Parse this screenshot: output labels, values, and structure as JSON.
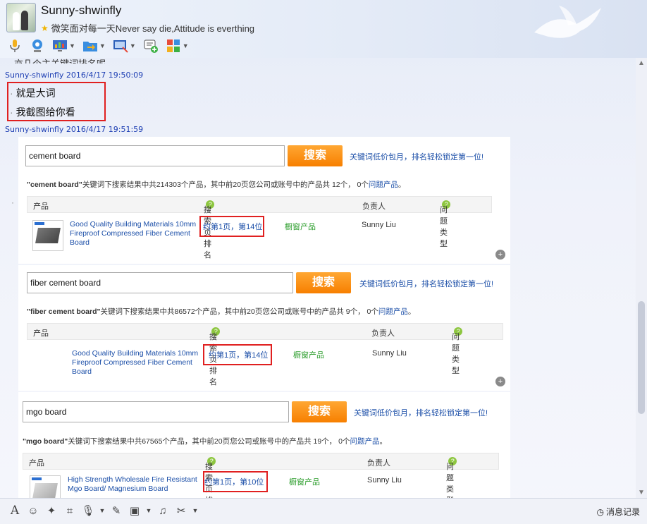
{
  "contact": {
    "name": "Sunny-shwinfly",
    "signature": "微笑面对每一天Never say die,Attitude is everthing"
  },
  "chat": {
    "cut_line": "亦几个主关键词排名呢",
    "messages": [
      {
        "header": "Sunny-shwinfly 2016/4/17 19:50:09",
        "lines": [
          "就是大词",
          "我截图给你看"
        ]
      },
      {
        "header": "Sunny-shwinfly 2016/4/17 19:51:59"
      }
    ]
  },
  "panels": [
    {
      "query": "cement board",
      "search_label": "搜索",
      "promo": "关键词低价包月，排名轻松锁定第一位!",
      "result_kw": "\"cement board\"",
      "result_text": "关键词下搜索结果中共214303个产品，其中前20页您公司或账号中的产品共 12个， 0个",
      "result_link": "问题产品",
      "result_end": "。",
      "headers": {
        "product": "产品",
        "rank": "搜索页排名",
        "owner": "负责人",
        "issue": "问题类型"
      },
      "row": {
        "title": "Good Quality Building Materials 10mm Fireproof Compressed Fiber Cement Board",
        "rank": "约第1页，第14位",
        "type": "橱窗产品",
        "owner": "Sunny Liu"
      }
    },
    {
      "query": "fiber cement board",
      "search_label": "搜索",
      "promo": "关键词低价包月，排名轻松锁定第一位!",
      "result_kw": "\"fiber cement board\"",
      "result_text": "关键词下搜索结果中共86572个产品，其中前20页您公司或账号中的产品共 9个， 0个",
      "result_link": "问题产品",
      "result_end": "。",
      "headers": {
        "product": "产品",
        "rank": "搜索页排名",
        "owner": "负责人",
        "issue": "问题类型"
      },
      "row": {
        "title": "Good Quality Building Materials 10mm Fireproof Compressed Fiber Cement Board",
        "rank": "约第1页，第14位",
        "type": "橱窗产品",
        "owner": "Sunny Liu"
      }
    },
    {
      "query": "mgo board",
      "search_label": "搜索",
      "promo": "关键词低价包月，排名轻松锁定第一位!",
      "result_kw": "\"mgo board\"",
      "result_text": "关键词下搜索结果中共67565个产品，其中前20页您公司或账号中的产品共 19个， 0个",
      "result_link": "问题产品",
      "result_end": "。",
      "headers": {
        "product": "产品",
        "rank": "搜索页排名",
        "owner": "负责人",
        "issue": "问题类型"
      },
      "row": {
        "title": "High Strength Wholesale Fire Resistant Mgo Board/ Magnesium Board",
        "rank": "约第1页，第10位",
        "type": "橱窗产品",
        "owner": "Sunny Liu"
      }
    }
  ],
  "bottom": {
    "history_label": "消息记录"
  },
  "colors": {
    "accent_link": "#1c4fa8",
    "search_button": "#f77f00",
    "highlight": "#e02020",
    "timestamp": "#1e3fb3"
  }
}
